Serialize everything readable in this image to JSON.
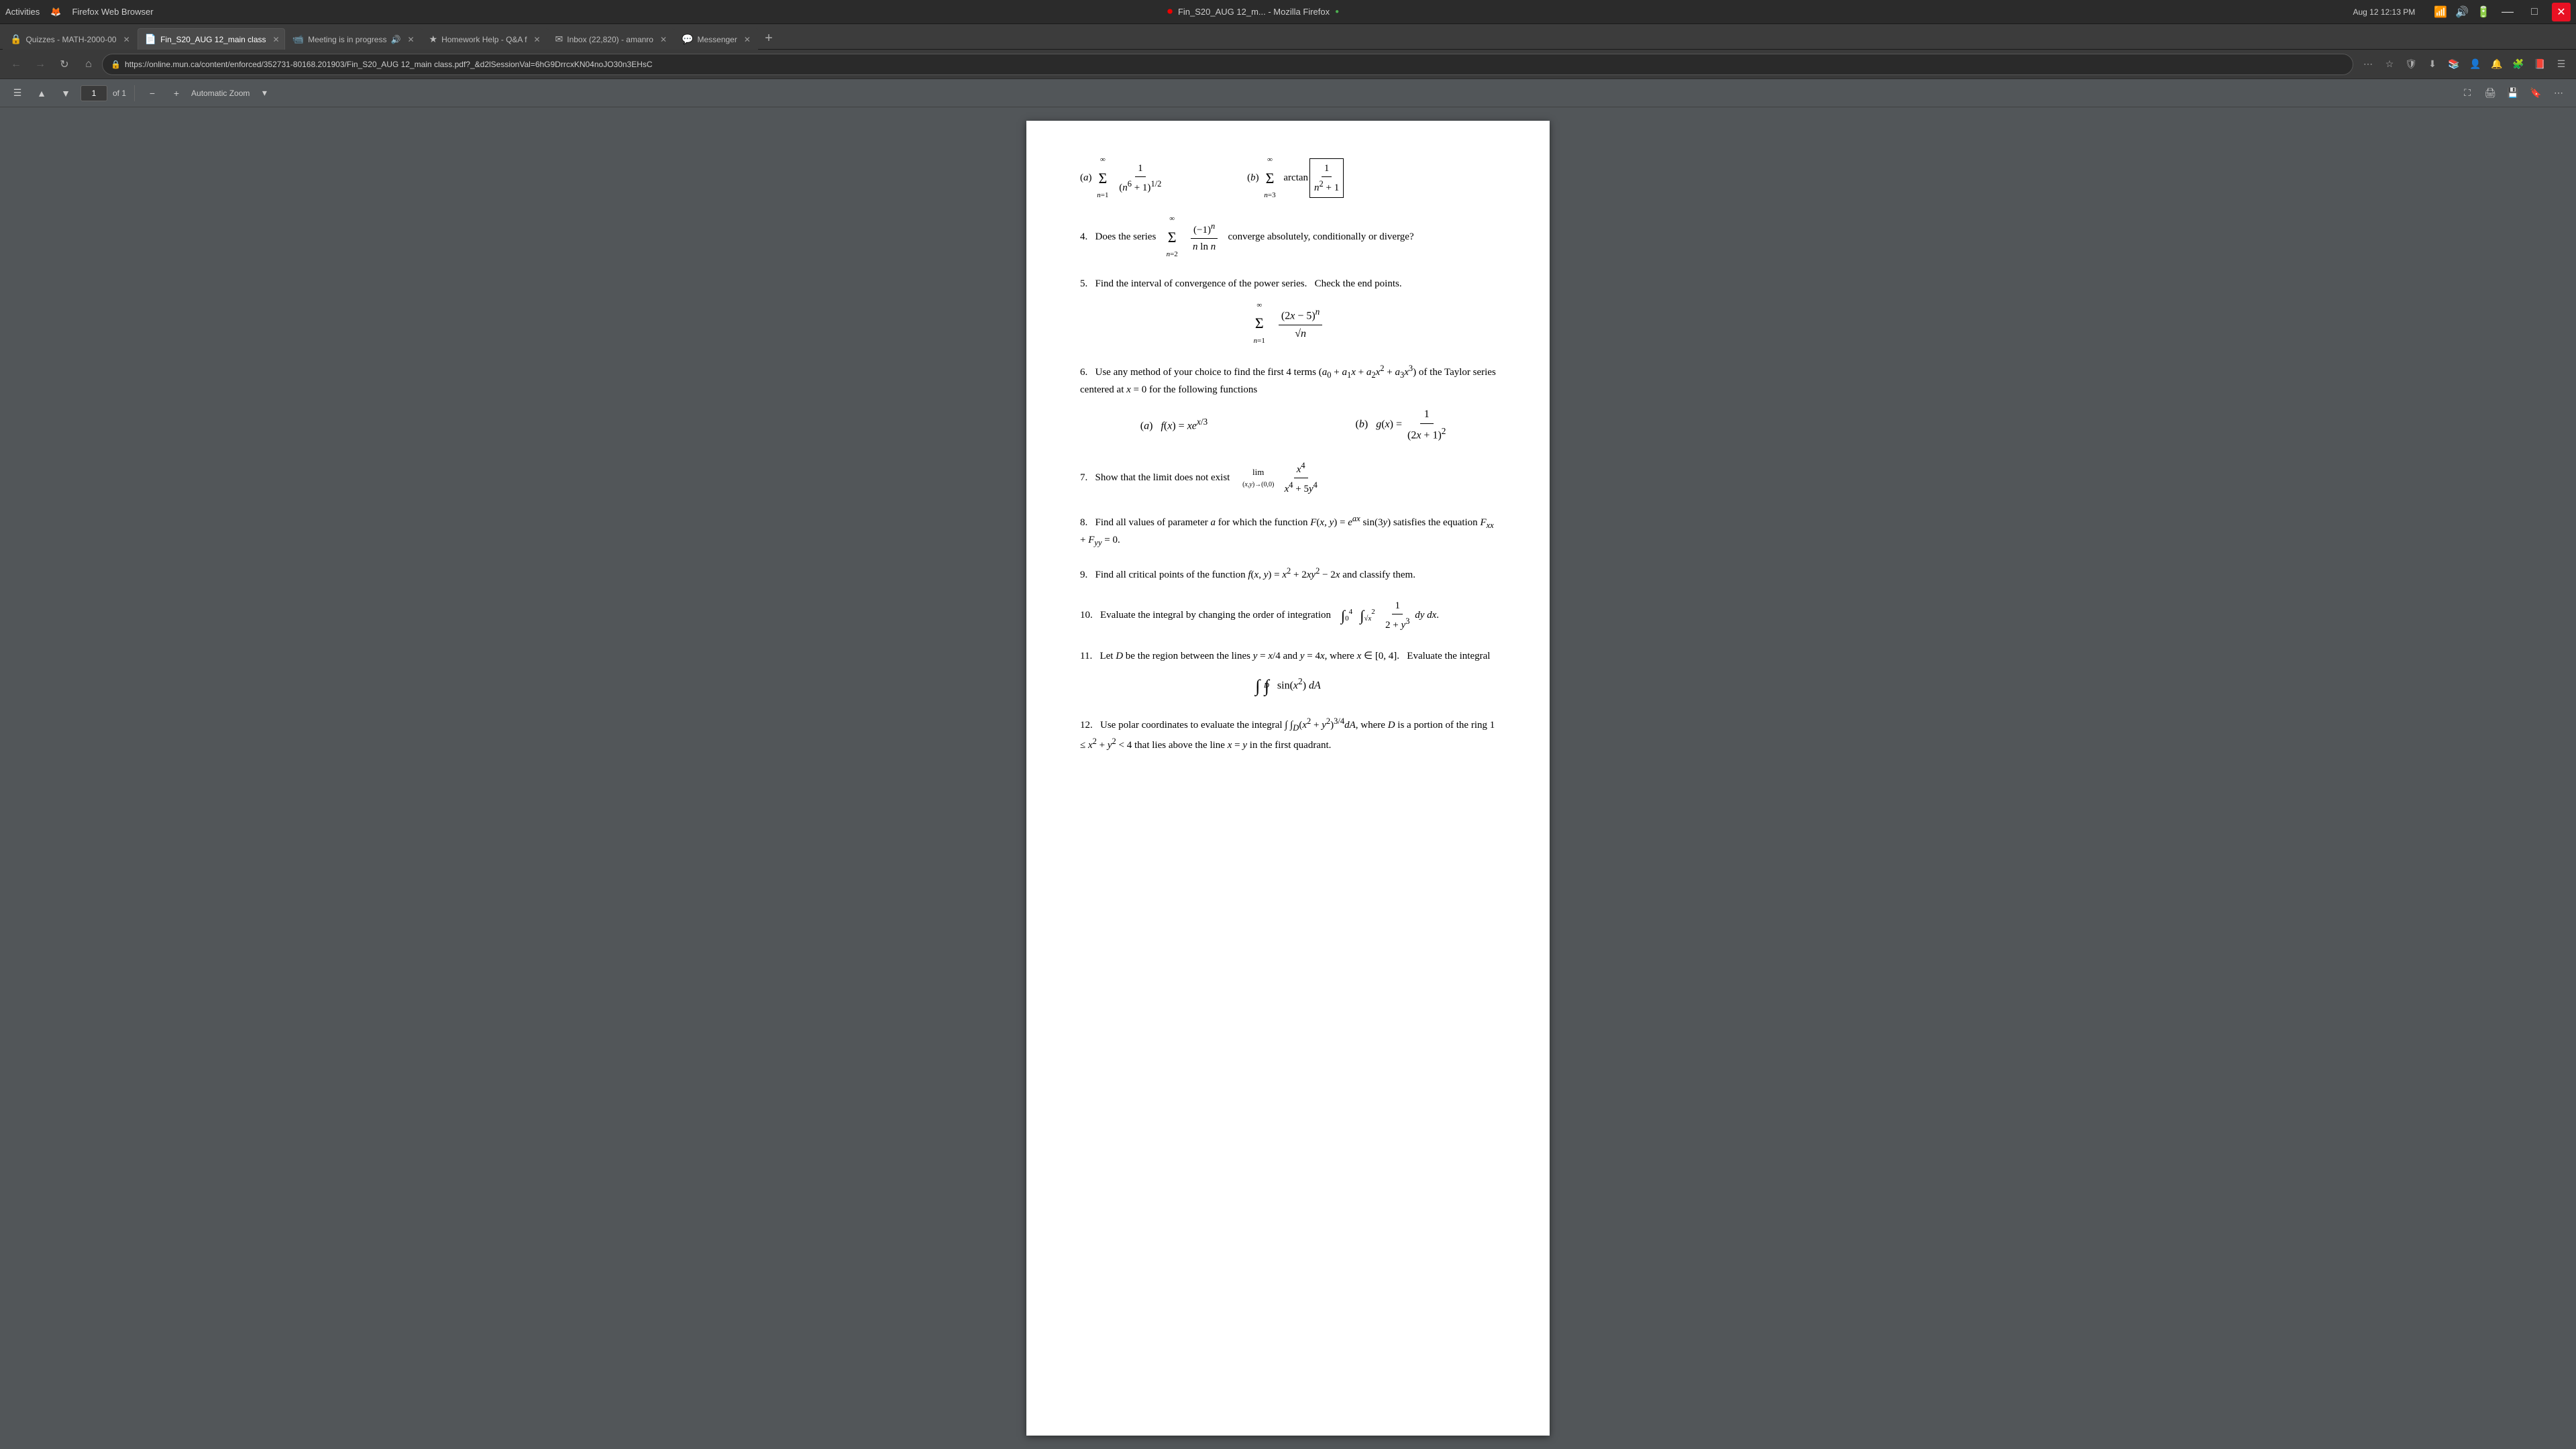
{
  "titlebar": {
    "left": "Activities",
    "browser_name": "Firefox Web Browser",
    "title": "Fin_S20_AUG 12_m... - Mozilla Firefox",
    "time": "Aug 12  12:13 PM",
    "dot": "●",
    "minimize": "—",
    "maximize": "□",
    "close": "✕"
  },
  "tabs": [
    {
      "id": "tab1",
      "label": "Quizzes - MATH-2000-00",
      "active": false,
      "icon": "🔒"
    },
    {
      "id": "tab2",
      "label": "Fin_S20_AUG 12_main class",
      "active": true,
      "icon": "📄"
    },
    {
      "id": "tab3",
      "label": "Meeting is in progress",
      "active": false,
      "icon": "📹"
    },
    {
      "id": "tab4",
      "label": "Homework Help - Q&A f",
      "active": false,
      "icon": "★"
    },
    {
      "id": "tab5",
      "label": "Inbox (22,820) - amanro",
      "active": false,
      "icon": "✉"
    },
    {
      "id": "tab6",
      "label": "Messenger",
      "active": false,
      "icon": "💬"
    }
  ],
  "navbar": {
    "url": "https://online.mun.ca/content/enforced/352731-80168.201903/Fin_S20_AUG 12_main class.pdf?_&d2lSessionVal=6hG9DrrcxKN04noJO30n3EHsC"
  },
  "pdf_toolbar": {
    "page_num": "1",
    "page_total": "of 1",
    "zoom_label": "Automatic Zoom"
  },
  "problems": [
    {
      "num": "4.",
      "text": "Does the series",
      "series": "∑(n=2 to ∞) (−1)ⁿ / (n ln n)",
      "suffix": "converge absolutely, conditionally or diverge?"
    },
    {
      "num": "5.",
      "text": "Find the interval of convergence of the power series.  Check the end points.",
      "series": "∑(n=1 to ∞) (2x−5)ⁿ / √n"
    },
    {
      "num": "6.",
      "text": "Use any method of your choice to find the first 4 terms (a₀ + a₁x + a₂x² + a₃x³) of the Taylor series centered at x = 0 for the following functions",
      "parts": [
        {
          "label": "(a)",
          "expr": "f(x) = xe^(x/3)"
        },
        {
          "label": "(b)",
          "expr": "g(x) = 1 / (2x + 1)²"
        }
      ]
    },
    {
      "num": "7.",
      "text": "Show that the limit does not exist",
      "limit": "lim_{(x,y)→(0,0)} x⁴ / (x⁴ + 5y⁴)"
    },
    {
      "num": "8.",
      "text": "Find all values of parameter a for which the function F(x, y) = e^(ax) sin(3y) satisfies the equation F_xx + F_yy = 0."
    },
    {
      "num": "9.",
      "text": "Find all critical points of the function f(x, y) = x² + 2xy² − 2x and classify them."
    },
    {
      "num": "10.",
      "text": "Evaluate the integral by changing the order of integration",
      "integral": "∫₀⁴ ∫_{√x}^{2} 1/(2 + y³) dy dx"
    },
    {
      "num": "11.",
      "text": "Let D be the region between the lines y = x/4 and y = 4x, where x ∈ [0, 4].  Evaluate the integral",
      "integral": "∬_D sin(x²) dA"
    },
    {
      "num": "12.",
      "text": "Use polar coordinates to evaluate the integral ∬_D (x² + y²)^(3/4) dA, where D is a portion of the ring 1 ≤ x² + y² < 4 that lies above the line x = y in the first quadrant."
    }
  ]
}
